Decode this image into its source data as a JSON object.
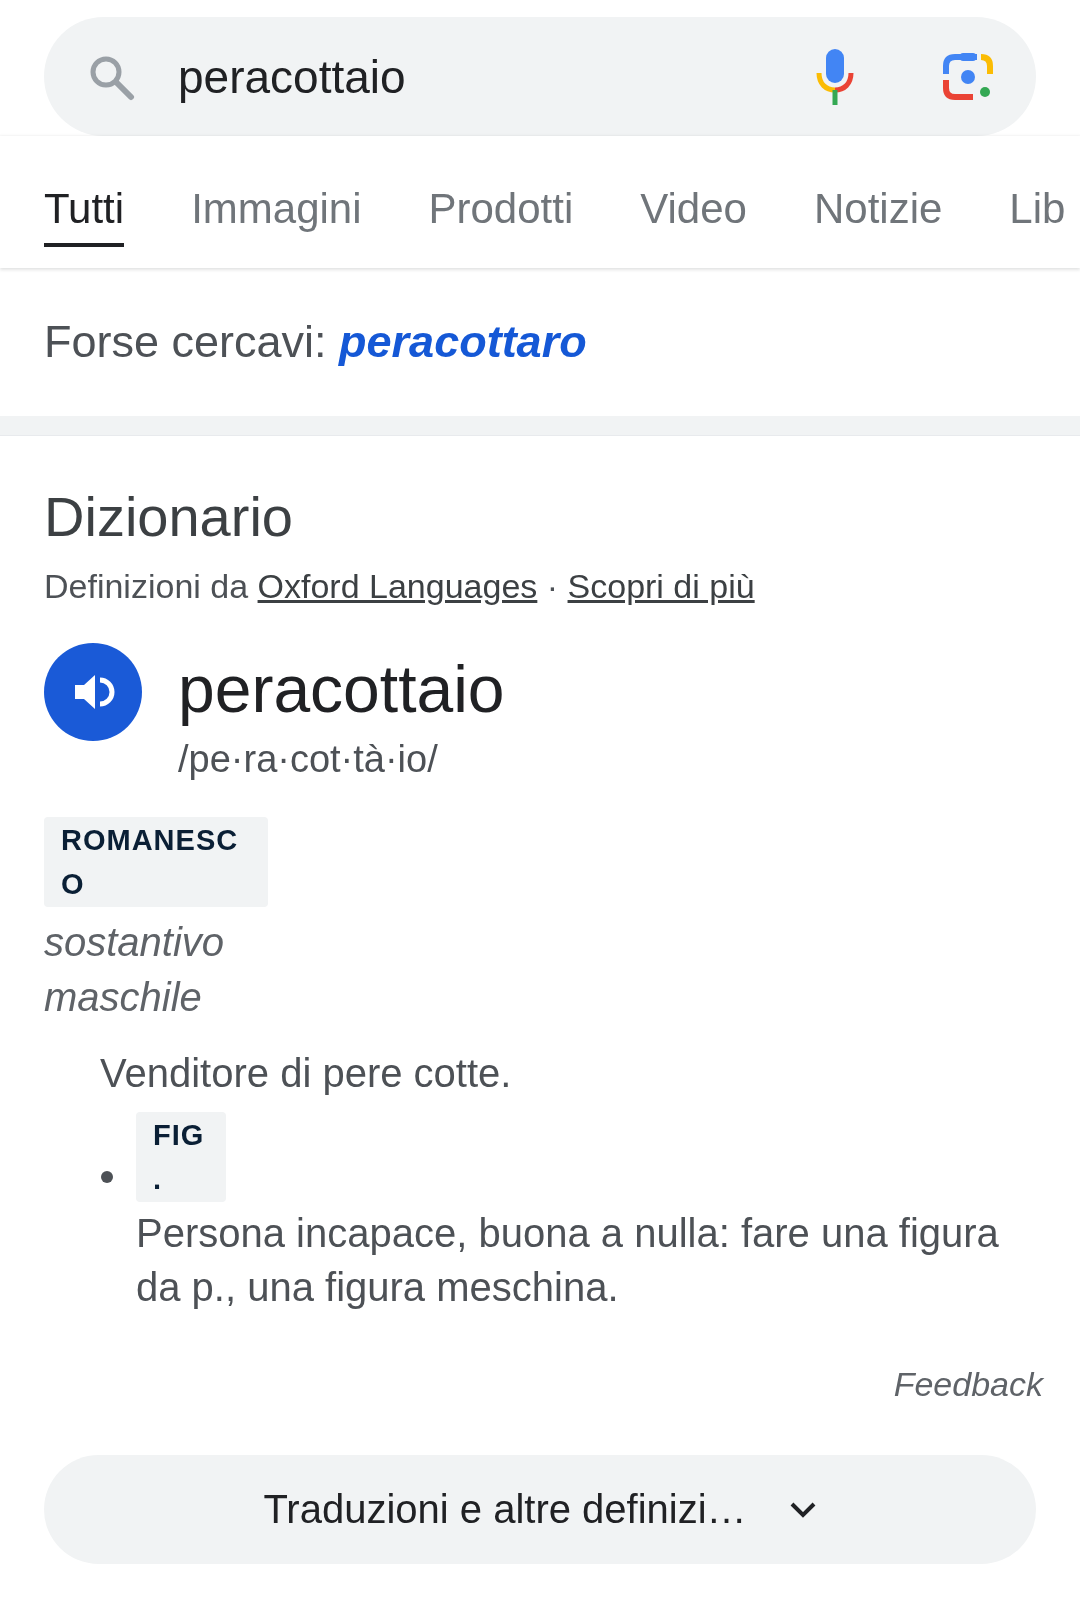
{
  "search_bar": {
    "value": "peracottaio"
  },
  "tabs": [
    {
      "label": "Tutti",
      "selected": true
    },
    {
      "label": "Immagini",
      "selected": false
    },
    {
      "label": "Prodotti",
      "selected": false
    },
    {
      "label": "Video",
      "selected": false
    },
    {
      "label": "Notizie",
      "selected": false
    },
    {
      "label": "Lib",
      "selected": false
    }
  ],
  "did_you_mean": {
    "prefix": "Forse cercavi:",
    "suggestion": "peracottaro"
  },
  "dictionary": {
    "title": "Dizionario",
    "source": {
      "prefix": "Definizioni da",
      "link": "Oxford Languages",
      "separator": "·",
      "more_link": "Scopri di più"
    },
    "word": "peracottaio",
    "pronunciation": "/pe·ra·cot·tà·io/",
    "register": "ROMANESCO",
    "part_of_speech": "sostantivo maschile",
    "senses": [
      {
        "kind": "plain",
        "text": "Venditore di pere cotte."
      },
      {
        "kind": "bulleted",
        "tag": "FIG.",
        "text": "Persona incapace, buona a nulla: fare una figura da p., una figura meschina."
      }
    ],
    "feedback": "Feedback"
  },
  "more_button": {
    "label": "Traduzioni e altre definizi…",
    "expanded": false
  }
}
